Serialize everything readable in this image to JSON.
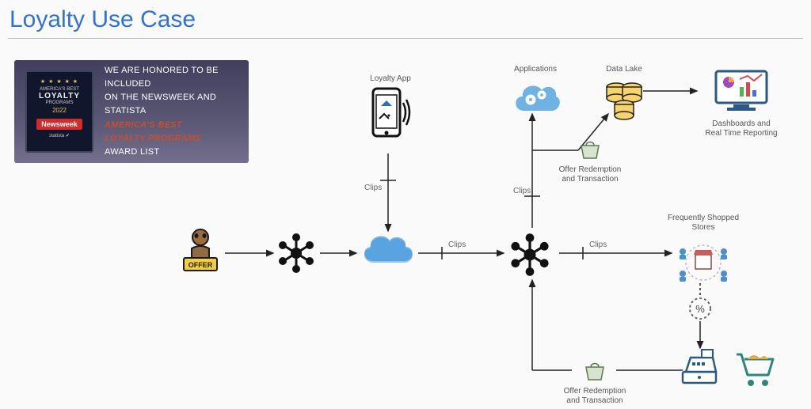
{
  "title": "Loyalty Use Case",
  "award": {
    "stars": "★ ★ ★ ★ ★",
    "badge_top": "AMERICA'S BEST",
    "badge_main": "LOYALTY",
    "badge_sub": "PROGRAMS",
    "badge_year": "2022",
    "newsweek": "Newsweek",
    "statista": "statista ✔",
    "line1": "WE ARE HONORED TO BE INCLUDED",
    "line2": "ON THE NEWSWEEK AND STATISTA",
    "line_red": "AMERICA'S BEST\nLOYALTY PROGRAMS",
    "line3": "AWARD LIST"
  },
  "nodes": {
    "loyalty_app": "Loyalty App",
    "applications": "Applications",
    "data_lake": "Data Lake",
    "dashboards": "Dashboards and\nReal Time Reporting",
    "offer_redemption_top": "Offer Redemption\nand Transaction",
    "offer_redemption_bottom": "Offer Redemption\nand Transaction",
    "frequently_shopped": "Frequently Shopped\nStores",
    "offer": "OFFER"
  },
  "edges": {
    "clips1": "Clips",
    "clips2": "Clips",
    "clips3": "Clips",
    "clips4": "Clips"
  }
}
